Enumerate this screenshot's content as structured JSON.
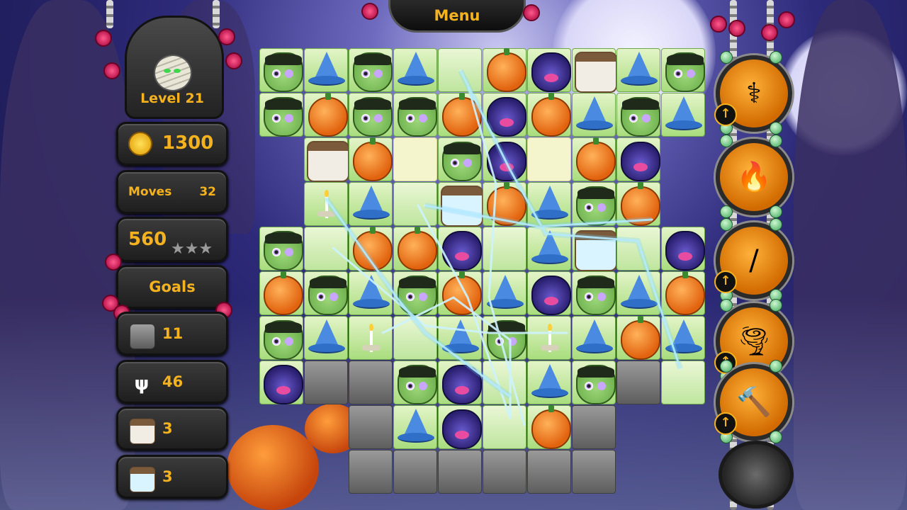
{
  "menu": {
    "label": "Menu"
  },
  "level": {
    "label": "Level 21"
  },
  "coins": {
    "value": "1300"
  },
  "moves": {
    "label": "Moves",
    "value": "32"
  },
  "score": {
    "value": "560",
    "stars_earned": 0,
    "stars_total": 3
  },
  "goals": {
    "title": "Goals",
    "items": [
      {
        "icon": "stone-tile-icon",
        "value": "11"
      },
      {
        "icon": "candelabra-icon",
        "value": "46"
      },
      {
        "icon": "jar-icon",
        "value": "3"
      },
      {
        "icon": "blue-jar-icon",
        "value": "3"
      }
    ]
  },
  "board": {
    "cols": 10,
    "rows": 10,
    "grid": [
      [
        "monster",
        "witch",
        "monster",
        "witch",
        "blank",
        "pumpkin",
        "bat",
        "jar",
        "witch",
        "monster"
      ],
      [
        "monster",
        "pumpkin",
        "monster",
        "monster",
        "pumpkin",
        "bat",
        "pumpkin",
        "witch",
        "monster",
        "witch"
      ],
      [
        null,
        "jar",
        "pumpkin",
        "blank",
        "monster",
        "bat",
        "blank",
        "pumpkin",
        "bat",
        null
      ],
      [
        null,
        "candle",
        "witch",
        "blank",
        "bluejar",
        "pumpkin",
        "witch",
        "monster",
        "pumpkin",
        null
      ],
      [
        "monster",
        "blank",
        "pumpkin",
        "pumpkin",
        "bat",
        "blank",
        "witch",
        "bluejar",
        "blank",
        "bat"
      ],
      [
        "pumpkin",
        "monster",
        "witch",
        "monster",
        "pumpkin",
        "witch",
        "bat",
        "monster",
        "witch",
        "pumpkin"
      ],
      [
        "monster",
        "witch",
        "candle",
        "blank",
        "witch",
        "monster",
        "candle",
        "witch",
        "pumpkin",
        "witch"
      ],
      [
        "bat",
        "stone",
        "stone",
        "monster",
        "bat",
        "blank",
        "witch",
        "monster",
        "stone",
        "blank"
      ],
      [
        null,
        null,
        "stone",
        "witch",
        "bat",
        "blank",
        "pumpkin",
        "stone",
        null,
        null
      ],
      [
        null,
        null,
        "stone",
        "stone",
        "stone",
        "stone",
        "stone",
        "stone",
        null,
        null
      ]
    ],
    "cream_cells": [
      [
        2,
        3
      ],
      [
        2,
        6
      ]
    ]
  },
  "boosters": [
    {
      "icon": "magic-staff-icon",
      "glyph": "⚕",
      "upgrade": true
    },
    {
      "icon": "torch-icon",
      "glyph": "🔥",
      "upgrade": false
    },
    {
      "icon": "wand-icon",
      "glyph": "/",
      "upgrade": true
    },
    {
      "icon": "tornado-icon",
      "glyph": "🌪",
      "upgrade": true
    },
    {
      "icon": "hammer-icon",
      "glyph": "🔨",
      "upgrade": true
    }
  ],
  "colors": {
    "accent": "#f4b21f",
    "board_tile": "#a9dd7e",
    "rose": "#d4145a"
  }
}
